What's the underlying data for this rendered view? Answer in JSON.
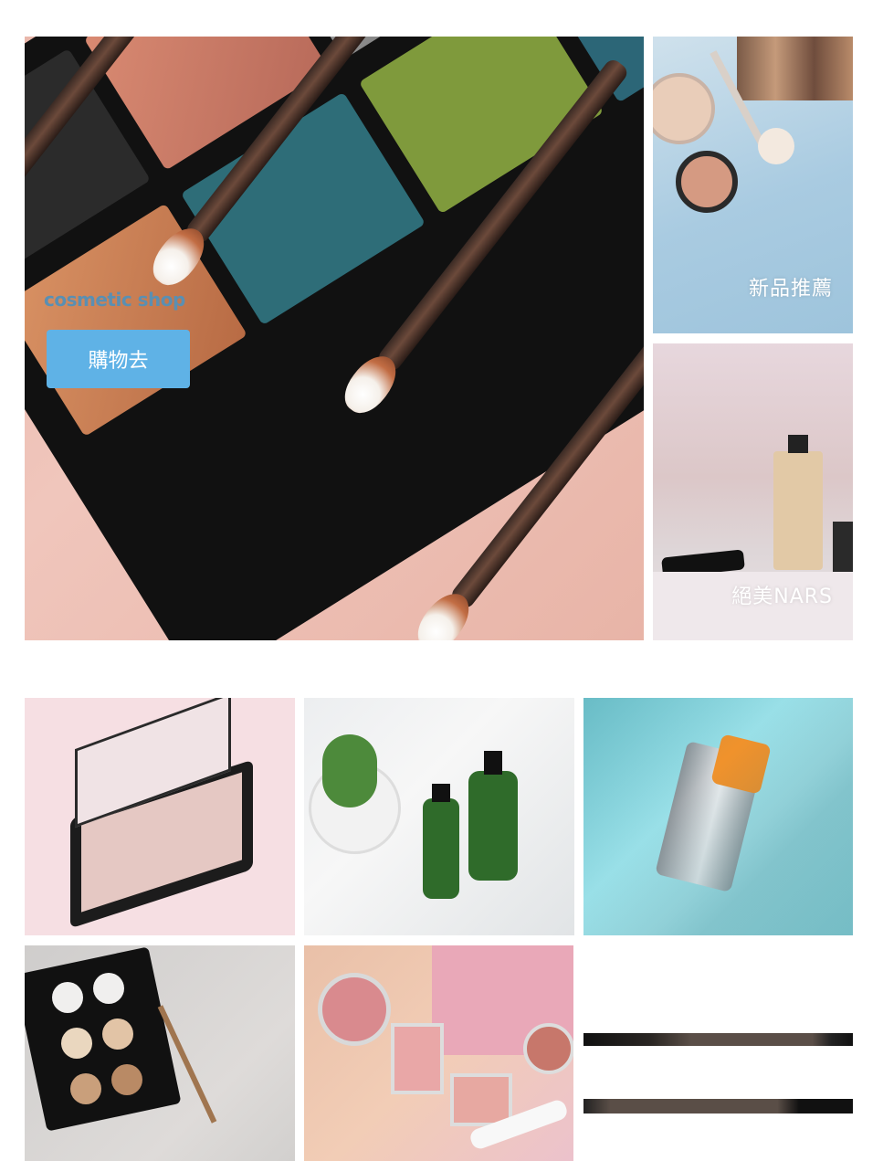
{
  "hero": {
    "brand": "cosmetic shop",
    "button_label": "購物去"
  },
  "tiles": {
    "new_arrivals": "新品推薦",
    "nars": "絕美NARS"
  },
  "colors": {
    "button_bg": "#5fb2e6",
    "brand_text": "#5a8fb2",
    "caption_text": "#ffffff"
  },
  "images": [
    {
      "name": "eyeshadow-palette-with-mirror-image"
    },
    {
      "name": "herbal-spray-bottles-image"
    },
    {
      "name": "sunscreen-tube-palm-shadow-image"
    },
    {
      "name": "contour-palette-and-brush-image"
    },
    {
      "name": "blush-compacts-pink-paper-image"
    },
    {
      "name": "eyeliner-pencils-image"
    }
  ]
}
